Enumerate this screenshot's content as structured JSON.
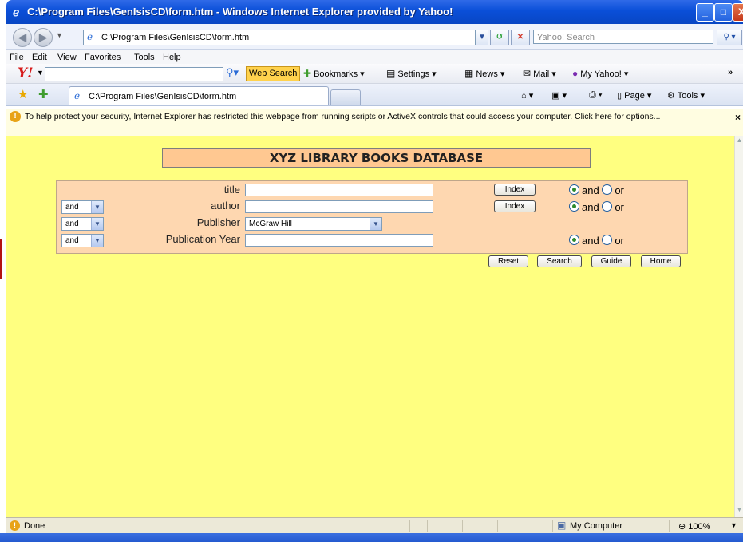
{
  "window": {
    "title": "C:\\Program Files\\GenIsisCD\\form.htm - Windows Internet Explorer provided by Yahoo!",
    "minimize": "_",
    "maximize": "□",
    "close": "X"
  },
  "addressbar": {
    "url": "C:\\Program Files\\GenIsisCD\\form.htm",
    "search_placeholder": "Yahoo! Search"
  },
  "menu": [
    "File",
    "Edit",
    "View",
    "Favorites",
    "Tools",
    "Help"
  ],
  "yahoo_toolbar": {
    "logo": "Y!",
    "web_search": "Web Search",
    "bookmarks": "Bookmarks",
    "settings": "Settings",
    "news": "News",
    "mail": "Mail",
    "my_yahoo": "My Yahoo!",
    "overflow": "»"
  },
  "tabs": {
    "active_label": "C:\\Program Files\\GenIsisCD\\form.htm",
    "page": "Page",
    "tools": "Tools"
  },
  "infobar": {
    "text": "To help protect your security, Internet Explorer has restricted this webpage from running scripts or ActiveX controls that could access your computer. Click here for options...",
    "close": "×"
  },
  "form": {
    "heading": "XYZ LIBRARY BOOKS DATABASE",
    "rows": [
      {
        "label": "title",
        "value": "",
        "has_index": true,
        "radio_and": "and",
        "radio_or": "or"
      },
      {
        "label": "author",
        "op": "and",
        "value": "",
        "has_index": true,
        "radio_and": "and",
        "radio_or": "or"
      },
      {
        "label": "Publisher",
        "op": "and",
        "select_value": "McGraw Hill"
      },
      {
        "label": "Publication Year",
        "op": "and",
        "value": "",
        "radio_and": "and",
        "radio_or": "or"
      }
    ],
    "index_label": "Index",
    "buttons": {
      "reset": "Reset",
      "search": "Search",
      "guide": "Guide",
      "home": "Home"
    }
  },
  "statusbar": {
    "status": "Done",
    "zone": "My Computer",
    "zoom": "100%"
  }
}
